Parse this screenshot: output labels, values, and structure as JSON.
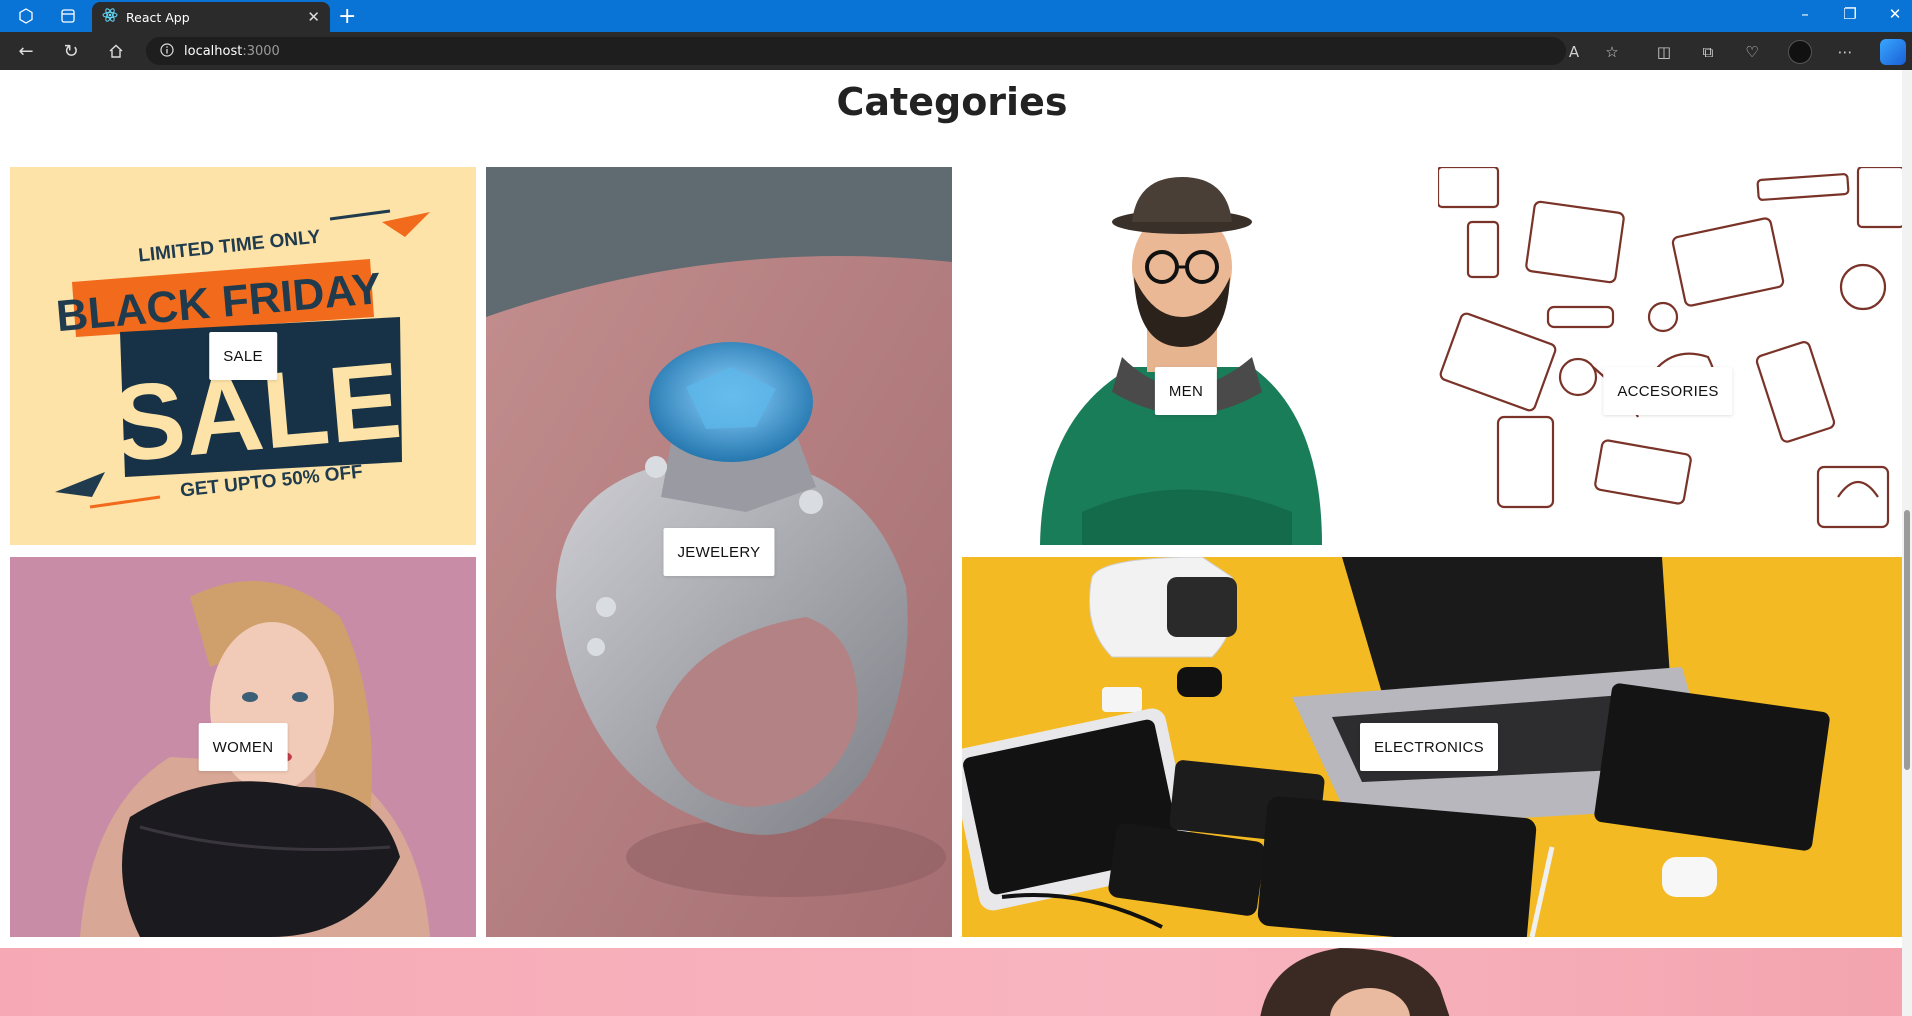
{
  "browser": {
    "tab_title": "React App",
    "url_host": "localhost",
    "url_port": ":3000",
    "accent": "#0a74d6"
  },
  "page": {
    "heading": "Categories",
    "categories": [
      {
        "key": "sale",
        "label": "SALE"
      },
      {
        "key": "jewelery",
        "label": "JEWELERY"
      },
      {
        "key": "men",
        "label": "MEN"
      },
      {
        "key": "accesories",
        "label": "ACCESORIES"
      },
      {
        "key": "women",
        "label": "WOMEN"
      },
      {
        "key": "electronics",
        "label": "ELECTRONICS"
      }
    ],
    "sale_image_text": {
      "line1": "LIMITED TIME ONLY",
      "line2": "BLACK FRIDAY",
      "line3": "SALE",
      "line4": "GET UPTO 50% OFF"
    }
  }
}
